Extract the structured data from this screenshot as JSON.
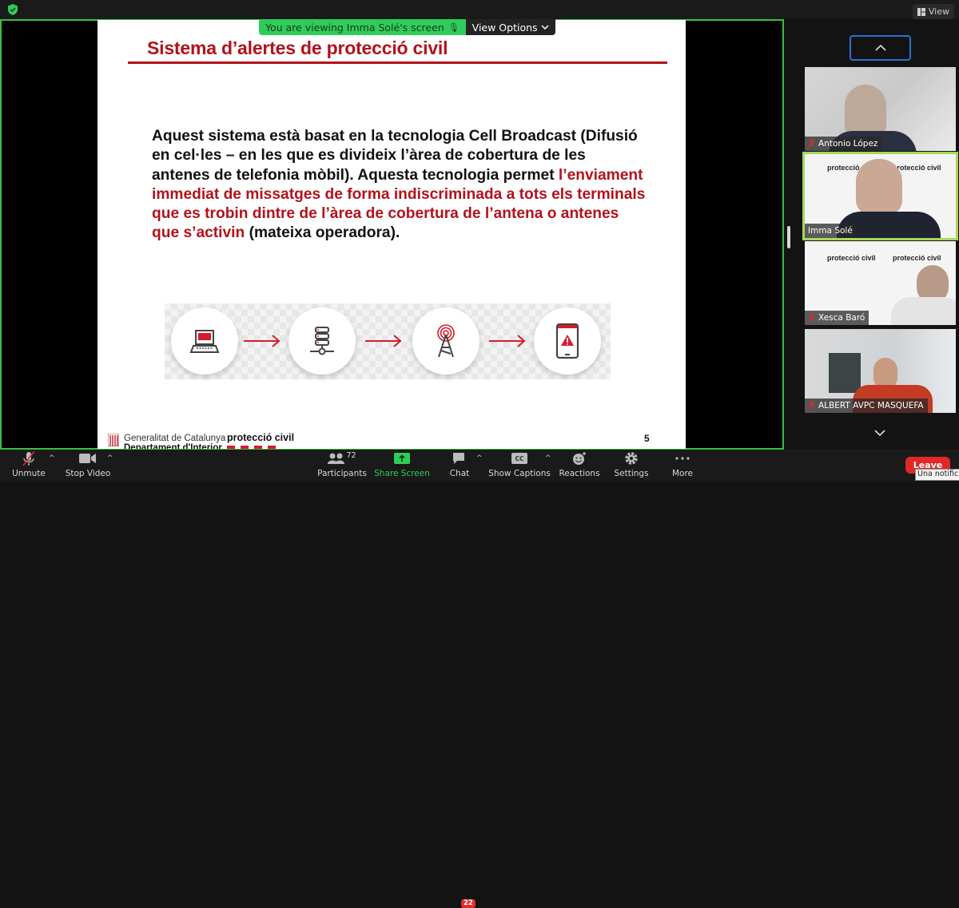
{
  "app": {
    "view_label": "View"
  },
  "banner": {
    "message": "You are viewing Imma Solé's screen",
    "view_options": "View Options"
  },
  "slide": {
    "title": "Sistema d’alertes de protecció civil",
    "body_black_1": "Aquest sistema està basat en la tecnologia Cell Broadcast (Difusió en cel·les  – en les que es divideix l’àrea de cobertura de les antenes de telefonia mòbil). Aquesta tecnologia permet ",
    "body_red": "l’enviament immediat de missatges de forma indiscriminada a tots els terminals que es trobin dintre de l’àrea de cobertura de l’antena o antenes que s’activin",
    "body_black_2": " (mateixa operadora).",
    "flow_steps": [
      {
        "icon": "laptop-icon"
      },
      {
        "icon": "server-network-icon"
      },
      {
        "icon": "broadcast-antenna-icon"
      },
      {
        "icon": "mobile-alert-icon"
      }
    ],
    "footer": {
      "org_line1": "Generalitat de Catalunya",
      "org_line2": "Departament d'Interior",
      "brand": "protecció civil",
      "page_number": "5"
    },
    "accent_color": "#b3121a"
  },
  "participants_gallery": [
    {
      "name": "Antonio López",
      "muted": true,
      "active": false
    },
    {
      "name": "Imma Solé",
      "muted": false,
      "active": true
    },
    {
      "name": "Xesca Baró",
      "muted": true,
      "active": false
    },
    {
      "name": "ALBERT AVPC MASQUEFA",
      "muted": true,
      "active": false
    }
  ],
  "toolbar": {
    "unmute": "Unmute",
    "stop_video": "Stop Video",
    "participants": "Participants",
    "participants_count": "72",
    "share_screen": "Share Screen",
    "chat": "Chat",
    "chat_badge": "22",
    "show_captions": "Show Captions",
    "cc": "CC",
    "reactions": "Reactions",
    "settings": "Settings",
    "more": "More",
    "leave": "Leave"
  },
  "tooltip": {
    "text": "Una notificació"
  },
  "colors": {
    "share_border": "#3bbf3b",
    "active_speaker": "#a5d85a",
    "leave": "#e02828",
    "share_green": "#2fcc5a"
  }
}
